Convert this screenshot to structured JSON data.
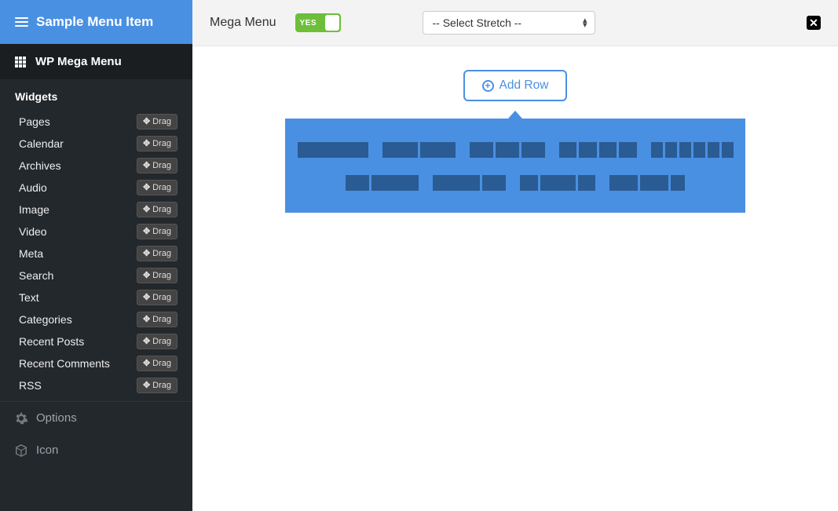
{
  "sidebar": {
    "header": "Sample Menu Item",
    "megaTitle": "WP Mega Menu",
    "widgetsTitle": "Widgets",
    "dragLabel": "Drag",
    "widgets": [
      "Pages",
      "Calendar",
      "Archives",
      "Audio",
      "Image",
      "Video",
      "Meta",
      "Search",
      "Text",
      "Categories",
      "Recent Posts",
      "Recent Comments",
      "RSS"
    ],
    "options": "Options",
    "icon": "Icon"
  },
  "toolbar": {
    "megaMenuLabel": "Mega Menu",
    "toggleText": "YES",
    "stretchPlaceholder": "-- Select Stretch --"
  },
  "canvas": {
    "addRow": "Add Row",
    "layouts": [
      [
        [
          1
        ],
        [
          1,
          1
        ],
        [
          1,
          1,
          1
        ],
        [
          1,
          1,
          1,
          1
        ],
        [
          1,
          1,
          1,
          1,
          1,
          1
        ]
      ],
      [
        [
          1,
          2
        ],
        [
          2,
          1
        ],
        [
          1,
          2,
          1
        ],
        [
          2,
          2,
          1
        ]
      ]
    ]
  }
}
